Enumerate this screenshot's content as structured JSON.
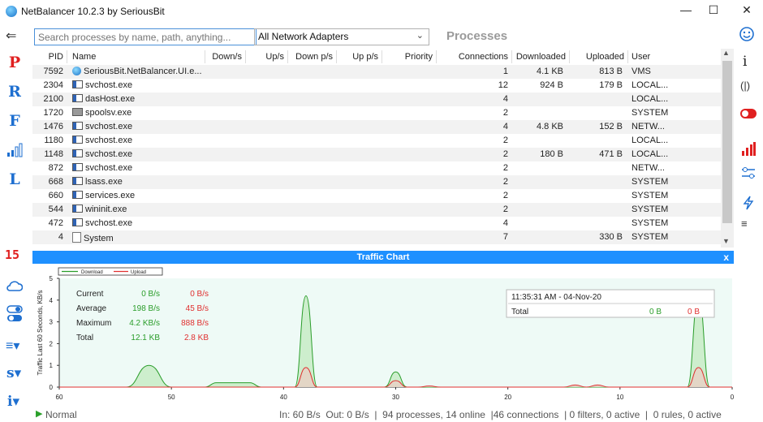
{
  "window": {
    "title": "NetBalancer 10.2.3 by SeriousBit",
    "controls": [
      "—",
      "☐",
      "✕"
    ]
  },
  "left_nav": {
    "back": "⇐",
    "letters": [
      "P",
      "R",
      "F",
      "L"
    ],
    "count": "15",
    "more": [
      "s▾",
      "i▾"
    ]
  },
  "search": {
    "placeholder": "Search processes by name, path, anything..."
  },
  "adapter": {
    "value": "All Network Adapters",
    "chevron": "⌄"
  },
  "processes_heading": "Processes",
  "table": {
    "columns": [
      "PID",
      "Name",
      "Down/s",
      "Up/s",
      "Down p/s",
      "Up p/s",
      "Priority",
      "Connections",
      "Downloaded",
      "Uploaded",
      "User"
    ],
    "rows": [
      {
        "pid": "7592",
        "name": "SeriousBit.NetBalancer.UI.e...",
        "icon": "globe",
        "conn": "1",
        "dl": "4.1 KB",
        "ul": "813 B",
        "user": "VMS"
      },
      {
        "pid": "2304",
        "name": "svchost.exe",
        "icon": "win",
        "conn": "12",
        "dl": "924 B",
        "ul": "179 B",
        "user": "LOCAL..."
      },
      {
        "pid": "2100",
        "name": "dasHost.exe",
        "icon": "win",
        "conn": "4",
        "dl": "",
        "ul": "",
        "user": "LOCAL..."
      },
      {
        "pid": "1720",
        "name": "spoolsv.exe",
        "icon": "print",
        "conn": "2",
        "dl": "",
        "ul": "",
        "user": "SYSTEM"
      },
      {
        "pid": "1476",
        "name": "svchost.exe",
        "icon": "win",
        "conn": "4",
        "dl": "4.8 KB",
        "ul": "152 B",
        "user": "NETW..."
      },
      {
        "pid": "1180",
        "name": "svchost.exe",
        "icon": "win",
        "conn": "2",
        "dl": "",
        "ul": "",
        "user": "LOCAL..."
      },
      {
        "pid": "1148",
        "name": "svchost.exe",
        "icon": "win",
        "conn": "2",
        "dl": "180 B",
        "ul": "471 B",
        "user": "LOCAL..."
      },
      {
        "pid": "872",
        "name": "svchost.exe",
        "icon": "win",
        "conn": "2",
        "dl": "",
        "ul": "",
        "user": "NETW..."
      },
      {
        "pid": "668",
        "name": "lsass.exe",
        "icon": "win",
        "conn": "2",
        "dl": "",
        "ul": "",
        "user": "SYSTEM"
      },
      {
        "pid": "660",
        "name": "services.exe",
        "icon": "win",
        "conn": "2",
        "dl": "",
        "ul": "",
        "user": "SYSTEM"
      },
      {
        "pid": "544",
        "name": "wininit.exe",
        "icon": "win",
        "conn": "2",
        "dl": "",
        "ul": "",
        "user": "SYSTEM"
      },
      {
        "pid": "472",
        "name": "svchost.exe",
        "icon": "win",
        "conn": "4",
        "dl": "",
        "ul": "",
        "user": "SYSTEM"
      },
      {
        "pid": "4",
        "name": "System",
        "icon": "file",
        "conn": "7",
        "dl": "",
        "ul": "330 B",
        "user": "SYSTEM"
      }
    ]
  },
  "traffic_chart": {
    "title": "Traffic Chart",
    "close": "x",
    "legend": [
      "Download",
      "Upload"
    ],
    "stats": [
      {
        "label": "Current",
        "down": "0 B/s",
        "up": "0 B/s"
      },
      {
        "label": "Average",
        "down": "198 B/s",
        "up": "45 B/s"
      },
      {
        "label": "Maximum",
        "down": "4.2 KB/s",
        "up": "888 B/s"
      },
      {
        "label": "Total",
        "down": "12.1 KB",
        "up": "2.8 KB"
      }
    ],
    "tooltip": {
      "time": "11:35:31 AM - 04-Nov-20",
      "label": "Total",
      "down": "0 B",
      "up": "0 B"
    },
    "ylabel": "Traffic Last 60 Seconds, KB/s",
    "colors": {
      "download": "#2a9d2a",
      "upload": "#e03030",
      "fill_down": "#c9ecc9",
      "bg": "#eefaf6"
    }
  },
  "chart_data": {
    "type": "area",
    "title": "",
    "xlabel": "",
    "ylabel": "Traffic Last 60 Seconds, KB/s",
    "xlim": [
      60,
      0
    ],
    "ylim": [
      0,
      5
    ],
    "x_ticks": [
      60,
      50,
      40,
      30,
      20,
      10,
      0
    ],
    "y_ticks": [
      0,
      1,
      2,
      3,
      4,
      5
    ],
    "series": [
      {
        "name": "Download",
        "color": "#2a9d2a",
        "points": [
          [
            60,
            0
          ],
          [
            54,
            0
          ],
          [
            52,
            1.0
          ],
          [
            50,
            0
          ],
          [
            47,
            0
          ],
          [
            46,
            0.2
          ],
          [
            43,
            0.2
          ],
          [
            42,
            0
          ],
          [
            39,
            0
          ],
          [
            38,
            4.2
          ],
          [
            37,
            0
          ],
          [
            31,
            0
          ],
          [
            30,
            0.7
          ],
          [
            29,
            0
          ],
          [
            4,
            0
          ],
          [
            3,
            4.2
          ],
          [
            2,
            0
          ],
          [
            0,
            0
          ]
        ]
      },
      {
        "name": "Upload",
        "color": "#e03030",
        "points": [
          [
            60,
            0
          ],
          [
            39,
            0
          ],
          [
            38,
            0.9
          ],
          [
            37,
            0
          ],
          [
            31,
            0
          ],
          [
            30,
            0.3
          ],
          [
            29,
            0
          ],
          [
            28,
            0
          ],
          [
            27,
            0.05
          ],
          [
            26,
            0
          ],
          [
            15,
            0
          ],
          [
            14,
            0.1
          ],
          [
            13,
            0
          ],
          [
            12,
            0.1
          ],
          [
            11,
            0
          ],
          [
            4,
            0
          ],
          [
            3,
            0.9
          ],
          [
            2,
            0
          ],
          [
            0,
            0
          ]
        ]
      }
    ]
  },
  "status": {
    "state": "Normal",
    "summary": "In: 60 B/s  Out: 0 B/s  |  94 processes, 14 online  |46 connections  | 0 filters, 0 active  |  0 rules, 0 active"
  }
}
